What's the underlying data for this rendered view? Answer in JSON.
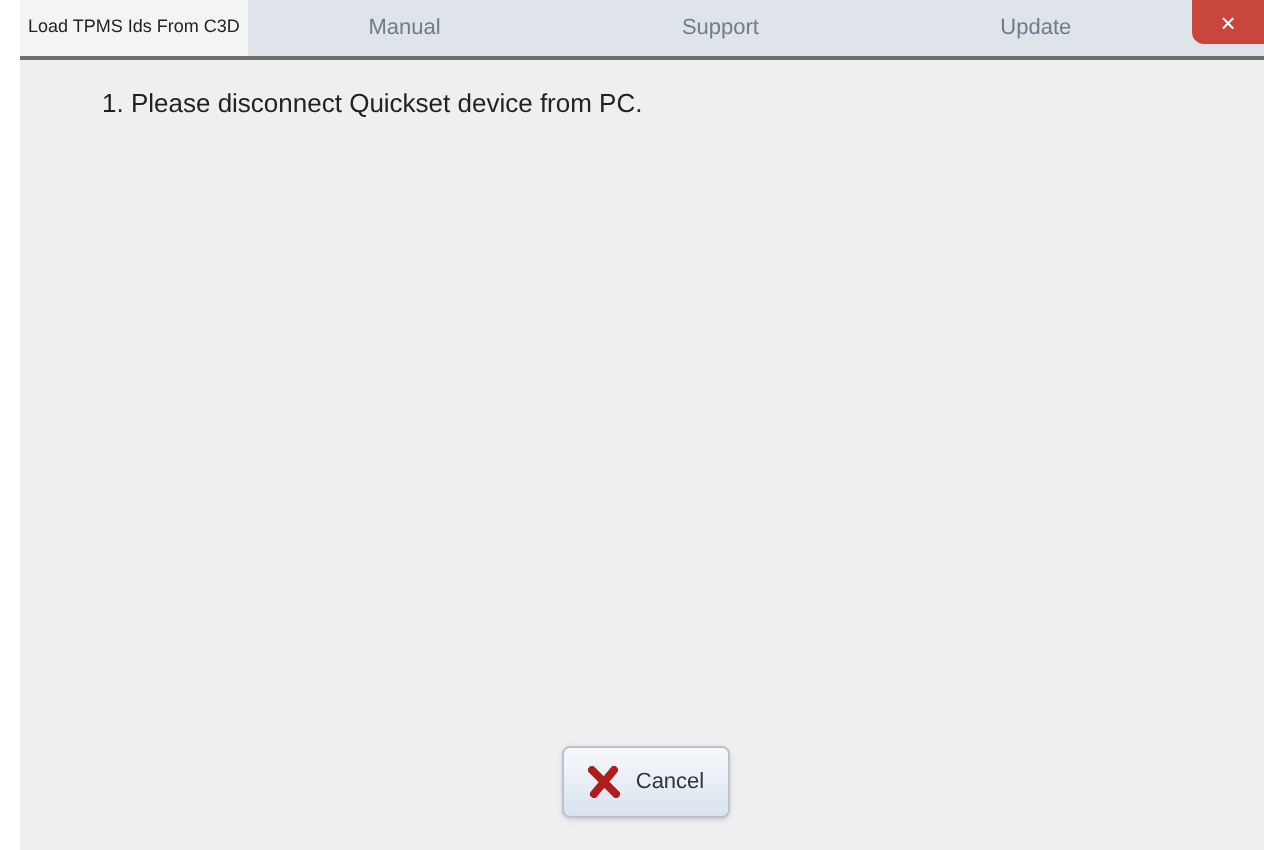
{
  "window": {
    "title": "Load TPMS Ids From C3D",
    "close": "×"
  },
  "background_toolbar": [
    "Manual",
    "Support",
    "Update"
  ],
  "message": "1. Please disconnect Quickset device from PC.",
  "buttons": [
    {
      "kind": "cancel",
      "label": "Cancel"
    }
  ]
}
